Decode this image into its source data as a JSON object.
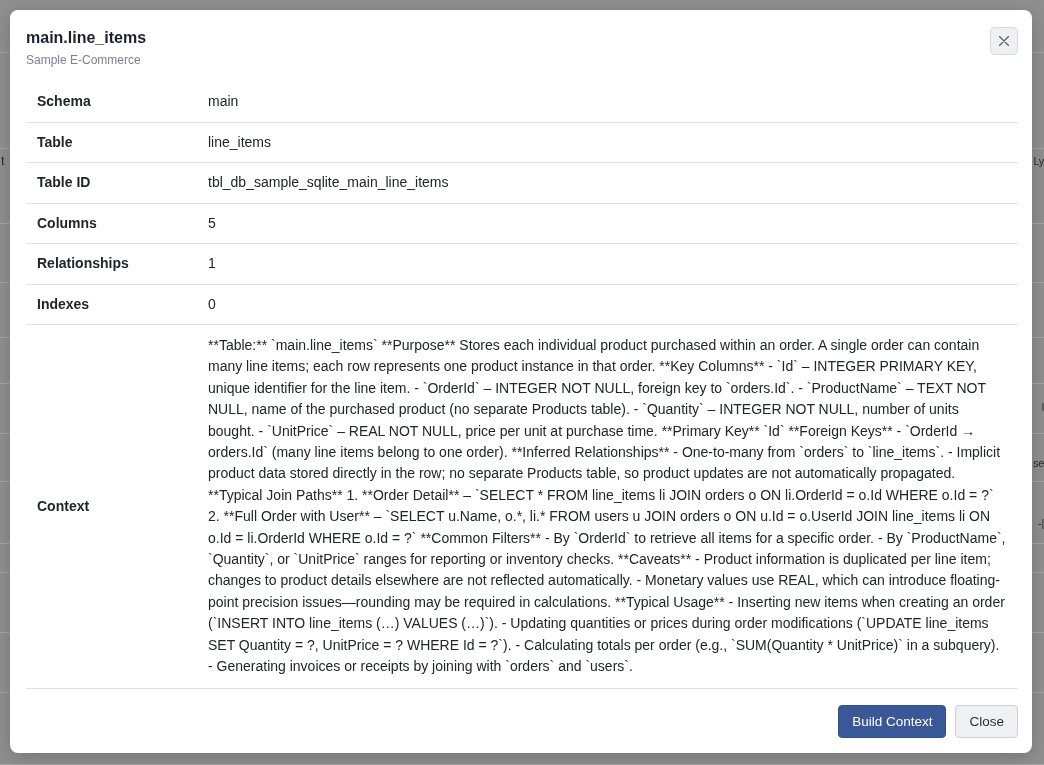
{
  "background_rows": [
    {
      "left": "t",
      "right": "Ly"
    },
    {
      "right": "l"
    },
    {
      "right": "se"
    },
    {
      "right": "-|"
    }
  ],
  "dialog": {
    "title": "main.line_items",
    "subtitle": "Sample E-Commerce"
  },
  "details": [
    {
      "label": "Schema",
      "value": "main"
    },
    {
      "label": "Table",
      "value": "line_items"
    },
    {
      "label": "Table ID",
      "value": "tbl_db_sample_sqlite_main_line_items"
    },
    {
      "label": "Columns",
      "value": "5"
    },
    {
      "label": "Relationships",
      "value": "1"
    },
    {
      "label": "Indexes",
      "value": "0"
    },
    {
      "label": "Context",
      "value": "**Table:** `main.line_items` **Purpose** Stores each individual product purchased within an order. A single order can contain many line items; each row represents one product instance in that order. **Key Columns** - `Id` – INTEGER PRIMARY KEY, unique identifier for the line item. - `OrderId` – INTEGER NOT NULL, foreign key to `orders.Id`. - `ProductName` – TEXT NOT NULL, name of the purchased product (no separate Products table). - `Quantity` – INTEGER NOT NULL, number of units bought. - `UnitPrice` – REAL NOT NULL, price per unit at purchase time. **Primary Key** `Id` **Foreign Keys** - `OrderId → orders.Id` (many line items belong to one order). **Inferred Relationships** - One-to-many from `orders` to `line_items`. - Implicit product data stored directly in the row; no separate Products table, so product updates are not automatically propagated. **Typical Join Paths** 1. **Order Detail** – `SELECT * FROM line_items li JOIN orders o ON li.OrderId = o.Id WHERE o.Id = ?` 2. **Full Order with User** – `SELECT u.Name, o.*, li.* FROM users u JOIN orders o ON u.Id = o.UserId JOIN line_items li ON o.Id = li.OrderId WHERE o.Id = ?` **Common Filters** - By `OrderId` to retrieve all items for a specific order. - By `ProductName`, `Quantity`, or `UnitPrice` ranges for reporting or inventory checks. **Caveats** - Product information is duplicated per line item; changes to product details elsewhere are not reflected automatically. - Monetary values use REAL, which can introduce floating-point precision issues—rounding may be required in calculations. **Typical Usage** - Inserting new items when creating an order (`INSERT INTO line_items (…) VALUES (…)`). - Updating quantities or prices during order modifications (`UPDATE line_items SET Quantity = ?, UnitPrice = ? WHERE Id = ?`). - Calculating totals per order (e.g., `SUM(Quantity * UnitPrice)` in a subquery). - Generating invoices or receipts by joining with `orders` and `users`."
    }
  ],
  "buttons": [
    {
      "label": "Build Context",
      "kind": "primary"
    },
    {
      "label": "Close",
      "kind": "secondary"
    }
  ]
}
